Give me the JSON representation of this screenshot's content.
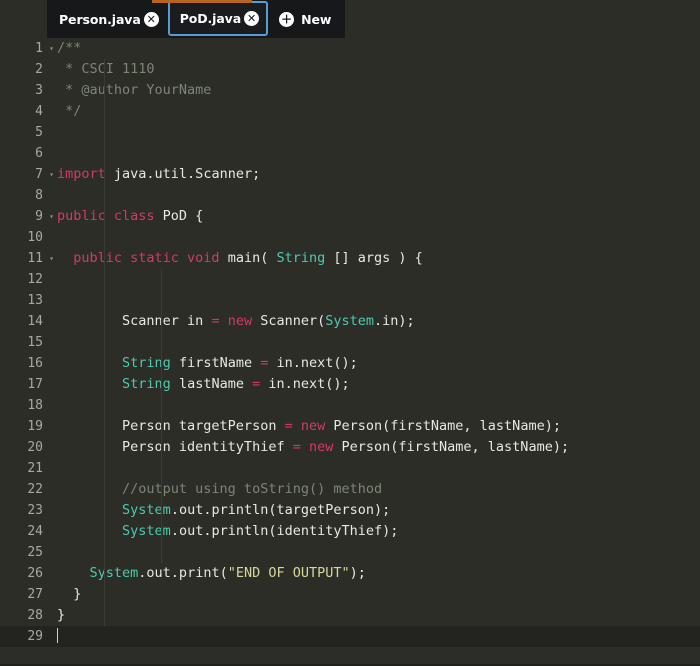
{
  "window": {
    "background_color": "#2b2d26",
    "accent_color": "#b5651d"
  },
  "tabbar": {
    "active_tab_border_color": "#5b9bd5",
    "tabs": [
      {
        "label": "Person.java",
        "active": false,
        "close_icon": "close-icon",
        "close_glyph": "✕"
      },
      {
        "label": "PoD.java",
        "active": true,
        "close_icon": "close-icon",
        "close_glyph": "✕"
      }
    ],
    "new_tab": {
      "label": "New",
      "icon": "plus-icon",
      "glyph": "＋"
    }
  },
  "editor": {
    "language": "java",
    "filename": "PoD.java",
    "current_line": 29,
    "total_lines": 29,
    "colors": {
      "comment": "#7d8574",
      "keyword": "#d7386a",
      "type": "#4ec9b0",
      "string": "#d7d79a",
      "plain": "#e8e8e3",
      "gutter": "#a8aa9e",
      "current_line_bg": "#232420"
    },
    "lines": [
      {
        "n": "1",
        "fold": true,
        "tokens": [
          {
            "t": "/**",
            "c": "cmt"
          }
        ]
      },
      {
        "n": "2",
        "fold": false,
        "tokens": [
          {
            "t": " * CSCI 1110",
            "c": "cmt"
          }
        ]
      },
      {
        "n": "3",
        "fold": false,
        "tokens": [
          {
            "t": " * @author YourName",
            "c": "cmt"
          }
        ]
      },
      {
        "n": "4",
        "fold": false,
        "tokens": [
          {
            "t": " */",
            "c": "cmt"
          }
        ]
      },
      {
        "n": "5",
        "fold": false,
        "tokens": []
      },
      {
        "n": "6",
        "fold": false,
        "tokens": []
      },
      {
        "n": "7",
        "fold": true,
        "tokens": [
          {
            "t": "import",
            "c": "kw"
          },
          {
            "t": " java.util.Scanner;",
            "c": "pln"
          }
        ]
      },
      {
        "n": "8",
        "fold": false,
        "tokens": []
      },
      {
        "n": "9",
        "fold": true,
        "tokens": [
          {
            "t": "public class",
            "c": "kw"
          },
          {
            "t": " PoD {",
            "c": "pln"
          }
        ]
      },
      {
        "n": "10",
        "fold": false,
        "tokens": []
      },
      {
        "n": "11",
        "fold": true,
        "tokens": [
          {
            "t": "  ",
            "c": "pln"
          },
          {
            "t": "public static void",
            "c": "kw"
          },
          {
            "t": " main( ",
            "c": "pln"
          },
          {
            "t": "String",
            "c": "typ"
          },
          {
            "t": " [] args ) {",
            "c": "pln"
          }
        ]
      },
      {
        "n": "12",
        "fold": false,
        "tokens": []
      },
      {
        "n": "13",
        "fold": false,
        "tokens": []
      },
      {
        "n": "14",
        "fold": false,
        "tokens": [
          {
            "t": "        Scanner in ",
            "c": "pln"
          },
          {
            "t": "=",
            "c": "op"
          },
          {
            "t": " ",
            "c": "pln"
          },
          {
            "t": "new",
            "c": "kw"
          },
          {
            "t": " Scanner(",
            "c": "pln"
          },
          {
            "t": "System",
            "c": "typ"
          },
          {
            "t": ".in);",
            "c": "pln"
          }
        ]
      },
      {
        "n": "15",
        "fold": false,
        "tokens": []
      },
      {
        "n": "16",
        "fold": false,
        "tokens": [
          {
            "t": "        ",
            "c": "pln"
          },
          {
            "t": "String",
            "c": "typ"
          },
          {
            "t": " firstName ",
            "c": "pln"
          },
          {
            "t": "=",
            "c": "op"
          },
          {
            "t": " in.next();",
            "c": "pln"
          }
        ]
      },
      {
        "n": "17",
        "fold": false,
        "tokens": [
          {
            "t": "        ",
            "c": "pln"
          },
          {
            "t": "String",
            "c": "typ"
          },
          {
            "t": " lastName ",
            "c": "pln"
          },
          {
            "t": "=",
            "c": "op"
          },
          {
            "t": " in.next();",
            "c": "pln"
          }
        ]
      },
      {
        "n": "18",
        "fold": false,
        "tokens": []
      },
      {
        "n": "19",
        "fold": false,
        "tokens": [
          {
            "t": "        Person targetPerson ",
            "c": "pln"
          },
          {
            "t": "=",
            "c": "op"
          },
          {
            "t": " ",
            "c": "pln"
          },
          {
            "t": "new",
            "c": "kw"
          },
          {
            "t": " Person(firstName, lastName);",
            "c": "pln"
          }
        ]
      },
      {
        "n": "20",
        "fold": false,
        "tokens": [
          {
            "t": "        Person identityThief ",
            "c": "pln"
          },
          {
            "t": "=",
            "c": "op"
          },
          {
            "t": " ",
            "c": "pln"
          },
          {
            "t": "new",
            "c": "kw"
          },
          {
            "t": " Person(firstName, lastName);",
            "c": "pln"
          }
        ]
      },
      {
        "n": "21",
        "fold": false,
        "tokens": []
      },
      {
        "n": "22",
        "fold": false,
        "tokens": [
          {
            "t": "        //output using toString() method",
            "c": "cmt"
          }
        ]
      },
      {
        "n": "23",
        "fold": false,
        "tokens": [
          {
            "t": "        ",
            "c": "pln"
          },
          {
            "t": "System",
            "c": "typ"
          },
          {
            "t": ".out.println(targetPerson);",
            "c": "pln"
          }
        ]
      },
      {
        "n": "24",
        "fold": false,
        "tokens": [
          {
            "t": "        ",
            "c": "pln"
          },
          {
            "t": "System",
            "c": "typ"
          },
          {
            "t": ".out.println(identityThief);",
            "c": "pln"
          }
        ]
      },
      {
        "n": "25",
        "fold": false,
        "tokens": []
      },
      {
        "n": "26",
        "fold": false,
        "tokens": [
          {
            "t": "    ",
            "c": "pln"
          },
          {
            "t": "System",
            "c": "typ"
          },
          {
            "t": ".out.print(",
            "c": "pln"
          },
          {
            "t": "\"END OF OUTPUT\"",
            "c": "str"
          },
          {
            "t": ");",
            "c": "pln"
          }
        ]
      },
      {
        "n": "27",
        "fold": false,
        "tokens": [
          {
            "t": "  }",
            "c": "pln"
          }
        ]
      },
      {
        "n": "28",
        "fold": false,
        "tokens": [
          {
            "t": "}",
            "c": "pln"
          }
        ]
      },
      {
        "n": "29",
        "fold": false,
        "tokens": [],
        "cursor": true
      }
    ]
  }
}
